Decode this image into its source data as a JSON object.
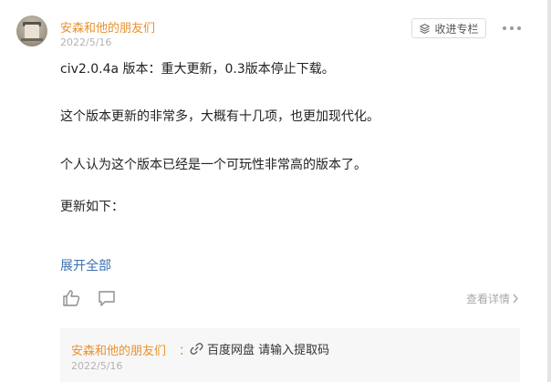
{
  "post": {
    "author": "安森和他的朋友们",
    "date": "2022/5/16",
    "collect_label": "收进专栏",
    "paragraphs": [
      "civ2.0.4a 版本：重大更新，0.3版本停止下载。",
      "这个版本更新的非常多，大概有十几项，也更加现代化。",
      "个人认为这个版本已经是一个可玩性非常高的版本了。",
      "更新如下："
    ],
    "expand_label": "展开全部",
    "detail_label": "查看详情"
  },
  "comment": {
    "author": "安森和他的朋友们",
    "separator": "：",
    "link_label": "百度网盘 请输入提取码",
    "date": "2022/5/16"
  },
  "icons": {
    "collect": "layers-icon",
    "more": "more-dots-icon",
    "like": "thumbs-up-icon",
    "comment": "comment-bubble-icon",
    "detail": "chevron-right-icon",
    "link": "link-icon"
  },
  "colors": {
    "author": "#e8912f",
    "link": "#3a6fb0",
    "muted": "#b3b3b3"
  }
}
